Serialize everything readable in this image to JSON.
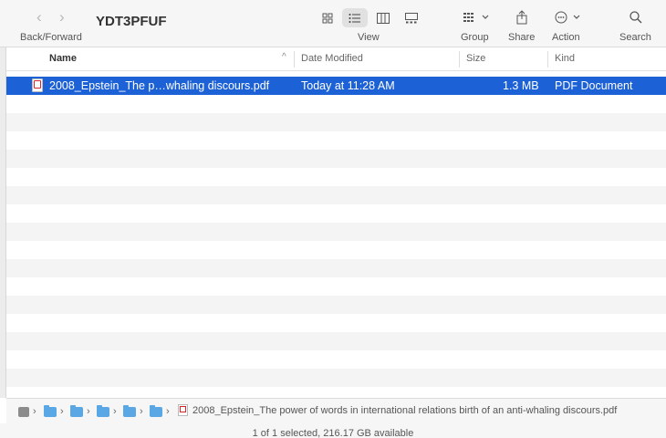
{
  "toolbar": {
    "title": "YDT3PFUF",
    "back_forward_label": "Back/Forward",
    "view_label": "View",
    "group_label": "Group",
    "share_label": "Share",
    "action_label": "Action",
    "search_label": "Search",
    "active_view": "list"
  },
  "columns": {
    "name": "Name",
    "date_modified": "Date Modified",
    "size": "Size",
    "kind": "Kind",
    "sort": "name-ascending"
  },
  "files": [
    {
      "name": "2008_Epstein_The p…whaling discours.pdf",
      "date_modified": "Today at 11:28 AM",
      "size": "1.3 MB",
      "kind": "PDF Document",
      "selected": true,
      "icon": "pdf-icon"
    }
  ],
  "path_bar": {
    "file_name": "2008_Epstein_The power of words in international relations birth of an anti-whaling discours.pdf",
    "segments": [
      "drive-icon",
      "folder-icon",
      "folder-icon",
      "folder-icon",
      "folder-icon",
      "folder-icon"
    ]
  },
  "status": "1 of 1 selected, 216.17 GB available",
  "colors": {
    "selection": "#1d61d6",
    "folder": "#5aa7e6",
    "pdf_mark": "#d8232a"
  }
}
